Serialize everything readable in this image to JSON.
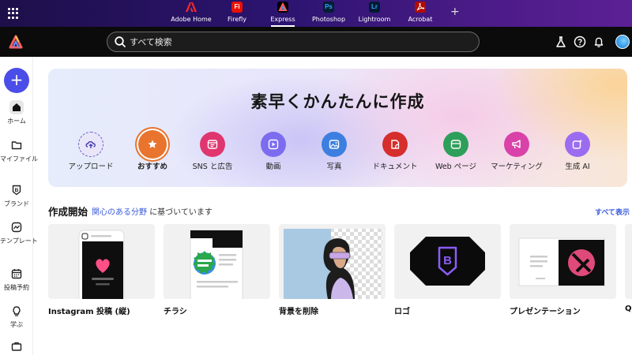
{
  "appbar": {
    "apps": [
      {
        "label": "Adobe Home",
        "icon": "adobe-logo-icon"
      },
      {
        "label": "Firefly",
        "icon": "Fi"
      },
      {
        "label": "Express",
        "icon": "express-logo-icon"
      },
      {
        "label": "Photoshop",
        "icon": "Ps"
      },
      {
        "label": "Lightroom",
        "icon": "Lr"
      },
      {
        "label": "Acrobat",
        "icon": "acrobat-logo-icon"
      }
    ],
    "add_app": "+"
  },
  "header": {
    "search_placeholder": "すべて検索"
  },
  "sidebar": {
    "create": "+",
    "items": [
      {
        "label": "ホーム",
        "icon": "home-icon"
      },
      {
        "label": "マイファイル",
        "icon": "folder-icon"
      },
      {
        "label": "ブランド",
        "icon": "brand-icon"
      },
      {
        "label": "テンプレート",
        "icon": "template-icon"
      },
      {
        "label": "投稿予約",
        "icon": "calendar-icon"
      },
      {
        "label": "学ぶ",
        "icon": "lightbulb-icon"
      },
      {
        "label": "",
        "icon": "briefcase-icon"
      }
    ]
  },
  "hero": {
    "title": "素早くかんたんに作成",
    "categories": [
      {
        "label": "アップロード",
        "color": "#e7e4f8"
      },
      {
        "label": "おすすめ",
        "color": "#e8742d"
      },
      {
        "label": "SNS と広告",
        "color": "#e0366f"
      },
      {
        "label": "動画",
        "color": "#7c6cf0"
      },
      {
        "label": "写真",
        "color": "#3d7fe0"
      },
      {
        "label": "ドキュメント",
        "color": "#d62d2d"
      },
      {
        "label": "Web ページ",
        "color": "#2e9f5a"
      },
      {
        "label": "マーケティング",
        "color": "#d942a8"
      },
      {
        "label": "生成 AI",
        "color": "#9b6cf0"
      }
    ]
  },
  "section": {
    "title": "作成開始",
    "sub_link": "関心のある分野",
    "sub_rest": "に基づいています",
    "see_all": "すべて表示"
  },
  "cards": [
    {
      "label": "Instagram 投稿 (縦)"
    },
    {
      "label": "チラシ"
    },
    {
      "label": "背景を削除"
    },
    {
      "label": "ロゴ"
    },
    {
      "label": "プレゼンテーション"
    },
    {
      "label": "QR"
    }
  ]
}
